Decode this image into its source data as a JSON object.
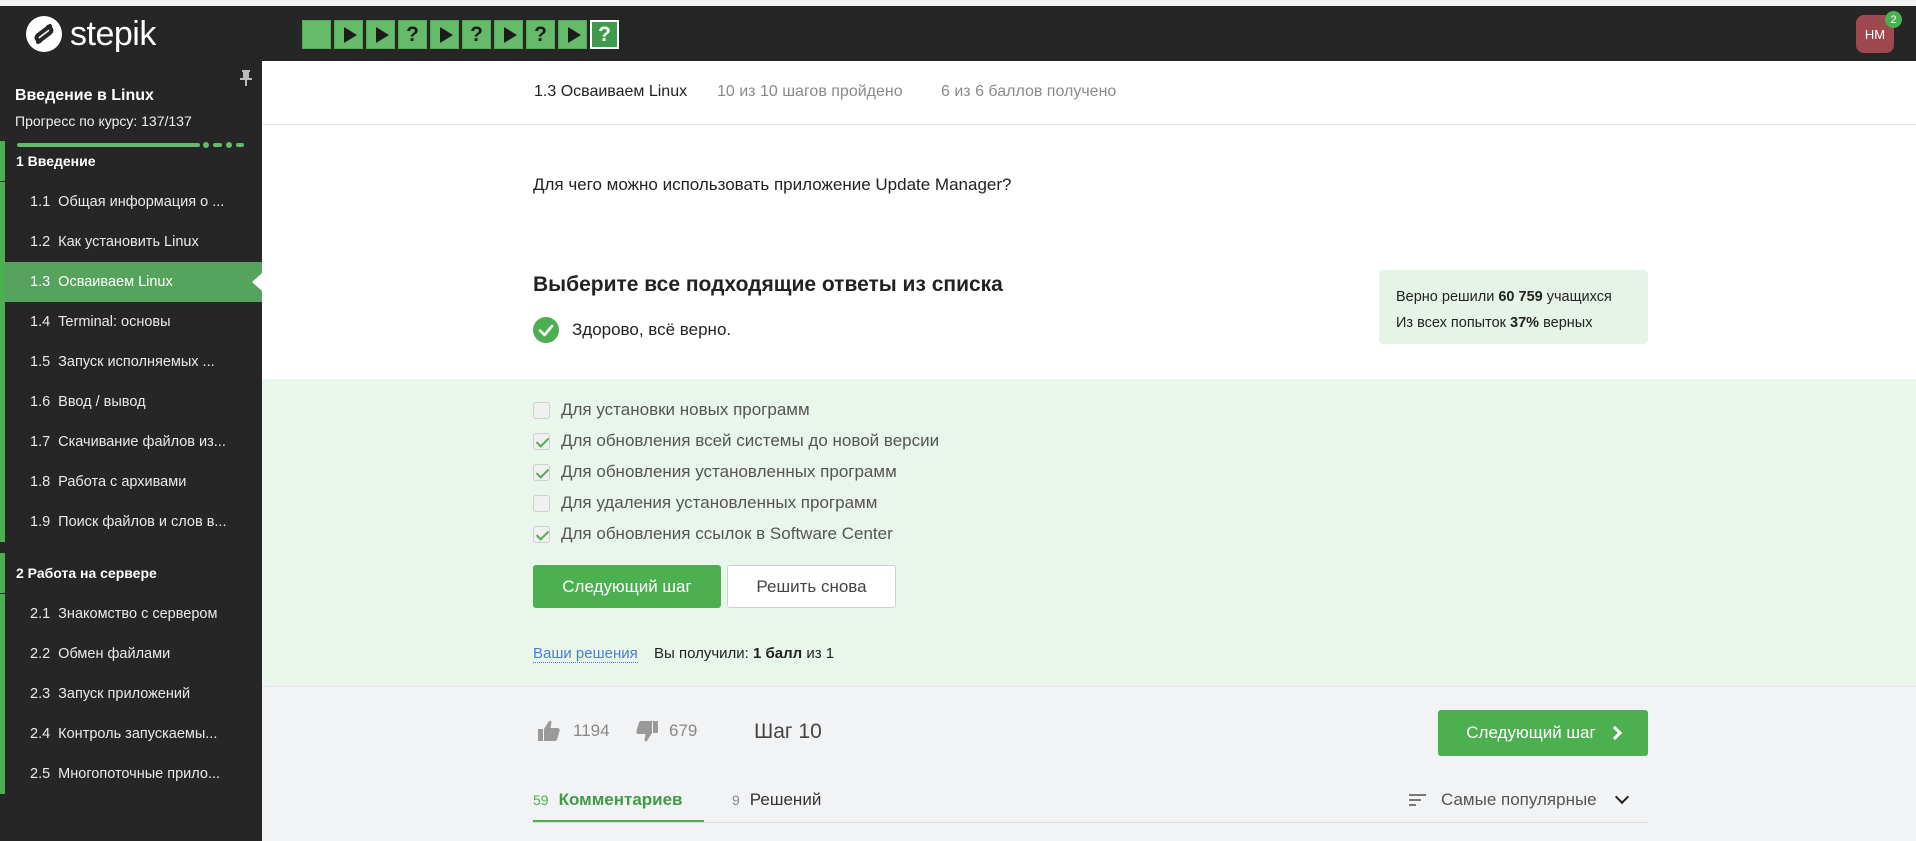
{
  "header": {
    "logo_text": "stepik",
    "steps": [
      "done",
      "video",
      "video",
      "question",
      "video",
      "question",
      "video",
      "question",
      "video",
      "question"
    ],
    "step_question_glyph": "?",
    "avatar_initials": "НМ",
    "notification_count": "2"
  },
  "sidebar": {
    "course_title": "Введение в Linux",
    "progress_text": "Прогресс по курсу:  137/137",
    "progress_fraction": 1.0,
    "modules": [
      {
        "label": "1  Введение",
        "lessons": [
          {
            "num": "1.1",
            "label": "Общая информация о ..."
          },
          {
            "num": "1.2",
            "label": "Как установить Linux"
          },
          {
            "num": "1.3",
            "label": "Осваиваем Linux"
          },
          {
            "num": "1.4",
            "label": "Terminal: основы"
          },
          {
            "num": "1.5",
            "label": "Запуск исполняемых ..."
          },
          {
            "num": "1.6",
            "label": "Ввод / вывод"
          },
          {
            "num": "1.7",
            "label": "Скачивание файлов из..."
          },
          {
            "num": "1.8",
            "label": "Работа с архивами"
          },
          {
            "num": "1.9",
            "label": "Поиск файлов и слов в..."
          }
        ]
      },
      {
        "label": "2  Работа на сервере",
        "lessons": [
          {
            "num": "2.1",
            "label": "Знакомство с сервером"
          },
          {
            "num": "2.2",
            "label": "Обмен файлами"
          },
          {
            "num": "2.3",
            "label": "Запуск приложений"
          },
          {
            "num": "2.4",
            "label": "Контроль запускаемы..."
          },
          {
            "num": "2.5",
            "label": "Многопоточные прило..."
          }
        ]
      }
    ],
    "active_lesson": "1.3"
  },
  "lesson_bar": {
    "title": "1.3 Осваиваем Linux",
    "steps_done": "10 из 10 шагов пройдено",
    "points": "6 из 6 баллов  получено"
  },
  "quiz": {
    "question": "Для чего можно использовать приложение Update Manager?",
    "instruction": "Выберите все подходящие ответы из списка",
    "feedback": "Здорово, всё верно.",
    "stats_line1_pre": "Верно решили ",
    "stats_line1_num": "60 759",
    "stats_line1_post": " учащихся",
    "stats_line2_pre": "Из всех попыток ",
    "stats_line2_num": "37%",
    "stats_line2_post": " верных",
    "options": [
      {
        "label": "Для установки новых программ",
        "checked": false
      },
      {
        "label": "Для обновления всей системы до новой версии",
        "checked": true
      },
      {
        "label": "Для обновления установленных программ",
        "checked": true
      },
      {
        "label": "Для удаления установленных программ",
        "checked": false
      },
      {
        "label": "Для обновления ссылок в Software Center",
        "checked": true
      }
    ],
    "next_button": "Следующий шаг",
    "retry_button": "Решить снова",
    "your_solutions_link": "Ваши решения",
    "score_pre": "Вы получили: ",
    "score_bold": "1 балл",
    "score_post": " из 1"
  },
  "footer": {
    "likes": "1194",
    "dislikes": "679",
    "step_label": "Шаг 10",
    "next_button": "Следующий шаг",
    "comments_count": "59",
    "comments_label": "Комментариев",
    "solutions_count": "9",
    "solutions_label": "Решений",
    "sort_label": "Самые популярные"
  },
  "colors": {
    "accent_green": "#4caf50",
    "header_bg": "#262626",
    "active_lesson_bg": "#55a35d",
    "link_blue": "#4a7fd4",
    "avatar_bg": "#a0484f"
  },
  "icons": [
    "logo-icon",
    "pin-icon",
    "check-circle-icon",
    "thumbs-up-icon",
    "thumbs-down-icon",
    "chevron-right-icon",
    "sort-icon",
    "chevron-down-icon"
  ]
}
